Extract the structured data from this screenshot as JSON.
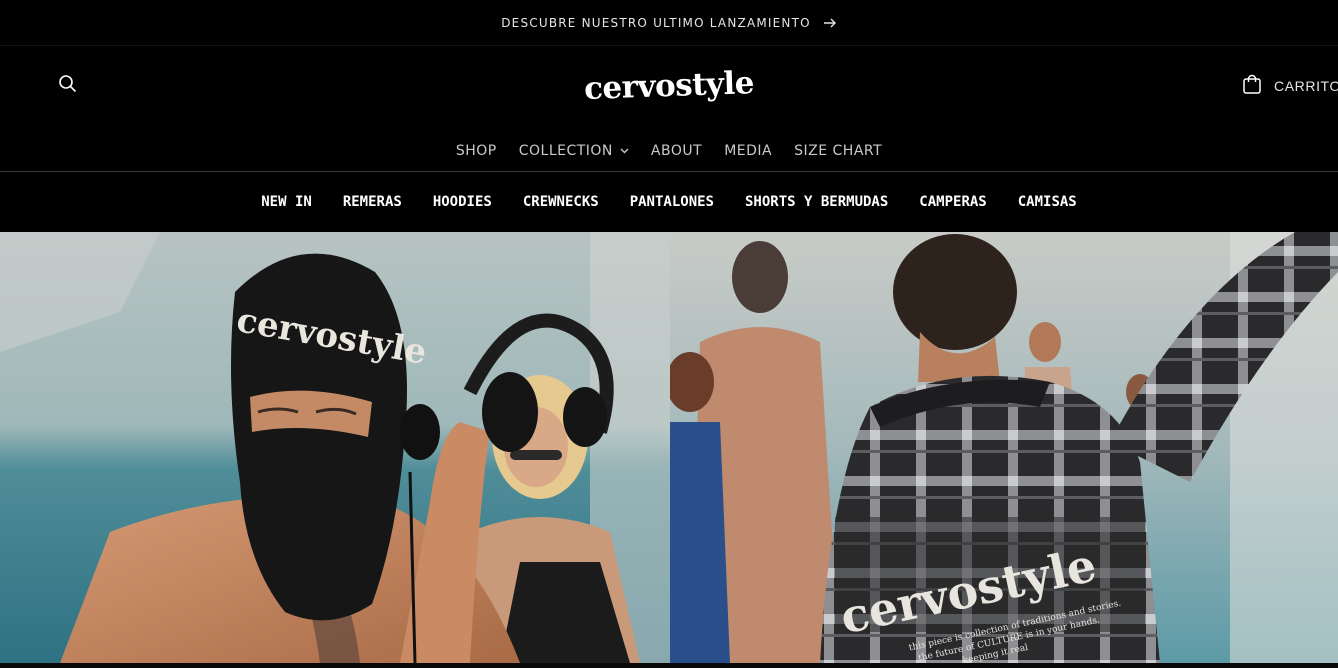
{
  "announcement": {
    "text": "DESCUBRE NUESTRO ULTIMO LANZAMIENTO",
    "icon": "arrow-right-icon"
  },
  "header": {
    "logo_text": "cervostyle",
    "search_icon": "search-icon",
    "cart": {
      "label": "CARRITO",
      "icon": "shopping-bag-icon"
    }
  },
  "main_nav": {
    "items": [
      {
        "label": "SHOP"
      },
      {
        "label": "COLLECTION",
        "has_dropdown": true
      },
      {
        "label": "ABOUT"
      },
      {
        "label": "MEDIA"
      },
      {
        "label": "SIZE CHART"
      }
    ]
  },
  "category_nav": {
    "items": [
      {
        "label": "NEW IN"
      },
      {
        "label": "REMERAS"
      },
      {
        "label": "HOODIES"
      },
      {
        "label": "CREWNECKS"
      },
      {
        "label": "PANTALONES"
      },
      {
        "label": "SHORTS Y BERMUDAS"
      },
      {
        "label": "CAMPERAS"
      },
      {
        "label": "CAMISAS"
      }
    ]
  },
  "hero": {
    "left_image": {
      "garment_text": "cervostyle"
    },
    "right_image": {
      "garment_text": "cervostyle",
      "garment_small_text": [
        "this piece is collection of traditions and stories",
        "the future of CULTURE is in your hands.",
        "keeping it real"
      ]
    }
  },
  "colors": {
    "background": "#000000",
    "text": "#ffffff",
    "nav_text": "#c9c9c9"
  }
}
